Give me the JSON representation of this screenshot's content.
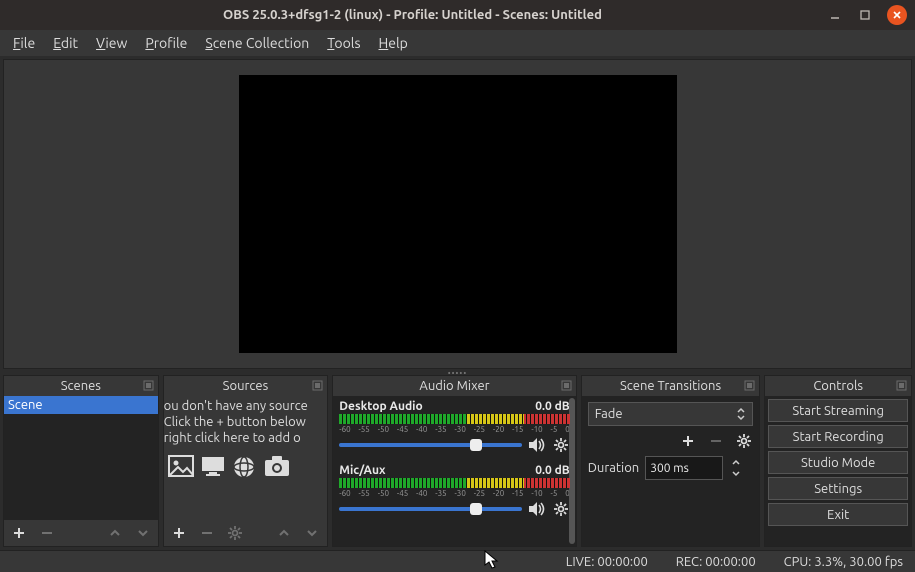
{
  "window": {
    "title": "OBS 25.0.3+dfsg1-2 (linux) - Profile: Untitled - Scenes: Untitled"
  },
  "menu": {
    "file": "File",
    "edit": "Edit",
    "view": "View",
    "profile": "Profile",
    "scene_collection": "Scene Collection",
    "tools": "Tools",
    "help": "Help"
  },
  "panels": {
    "scenes": {
      "title": "Scenes",
      "items": [
        "Scene"
      ]
    },
    "sources": {
      "title": "Sources",
      "hint_line1": "ou don't have any source",
      "hint_line2": "Click the + button below",
      "hint_line3": "right click here to add o"
    },
    "mixer": {
      "title": "Audio Mixer",
      "tracks": [
        {
          "name": "Desktop Audio",
          "db": "0.0 dB",
          "scale": [
            "-60",
            "-55",
            "-50",
            "-45",
            "-40",
            "-35",
            "-30",
            "-25",
            "-20",
            "-15",
            "-10",
            "-5",
            "0"
          ]
        },
        {
          "name": "Mic/Aux",
          "db": "0.0 dB",
          "scale": [
            "-60",
            "-55",
            "-50",
            "-45",
            "-40",
            "-35",
            "-30",
            "-25",
            "-20",
            "-15",
            "-10",
            "-5",
            "0"
          ]
        }
      ]
    },
    "transitions": {
      "title": "Scene Transitions",
      "selected": "Fade",
      "duration_label": "Duration",
      "duration_value": "300 ms"
    },
    "controls": {
      "title": "Controls",
      "buttons": {
        "start_stream": "Start Streaming",
        "start_record": "Start Recording",
        "studio": "Studio Mode",
        "settings": "Settings",
        "exit": "Exit"
      }
    }
  },
  "status": {
    "live": "LIVE: 00:00:00",
    "rec": "REC: 00:00:00",
    "cpu": "CPU: 3.3%, 30.00 fps"
  }
}
